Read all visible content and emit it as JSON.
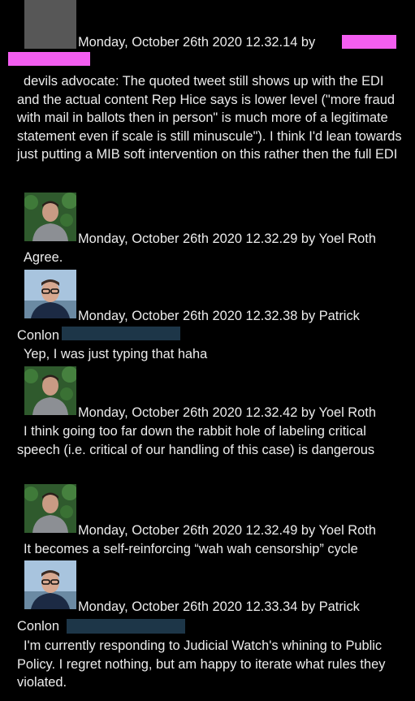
{
  "colors": {
    "background": "#000000",
    "text": "#ececec",
    "pink_redaction": "#f35ef0",
    "blue_redaction": "#1d3648"
  },
  "messages": [
    {
      "timestamp": "Monday, October 26th 2020 12.32.14 by",
      "author": "",
      "avatar": "redacted-gray",
      "text": "devils advocate: The quoted tweet still shows up with the EDI and the actual content Rep Hice says is lower level (\"more fraud with mail in ballots then in person\" is much more of a legitimate statement even if scale is still minuscule\"). I think I'd lean towards just putting a MIB soft intervention on this rather then the full EDI"
    },
    {
      "timestamp": "Monday, October 26th 2020 12.32.29 by Yoel Roth",
      "avatar": "man-green-background",
      "text": "Agree."
    },
    {
      "timestamp": "Monday, October 26th 2020 12.32.38 by Patrick",
      "author_cont": "Conlon",
      "avatar": "man-glasses-sky",
      "text": "Yep, I was just typing that haha"
    },
    {
      "timestamp": "Monday, October 26th 2020 12.32.42 by Yoel Roth",
      "avatar": "man-green-background",
      "text": "I think going too far down the rabbit hole of labeling critical speech (i.e. critical of our handling of this case) is dangerous"
    },
    {
      "timestamp": "Monday, October 26th 2020 12.32.49 by Yoel Roth",
      "avatar": "man-green-background",
      "text": "It becomes a self-reinforcing “wah wah censorship” cycle"
    },
    {
      "timestamp": "Monday, October 26th 2020 12.33.34 by Patrick",
      "author_cont": "Conlon",
      "avatar": "man-glasses-sky",
      "text": "I'm currently responding to Judicial Watch's whining to Public Policy. I regret nothing, but am happy to iterate what rules they violated."
    }
  ]
}
